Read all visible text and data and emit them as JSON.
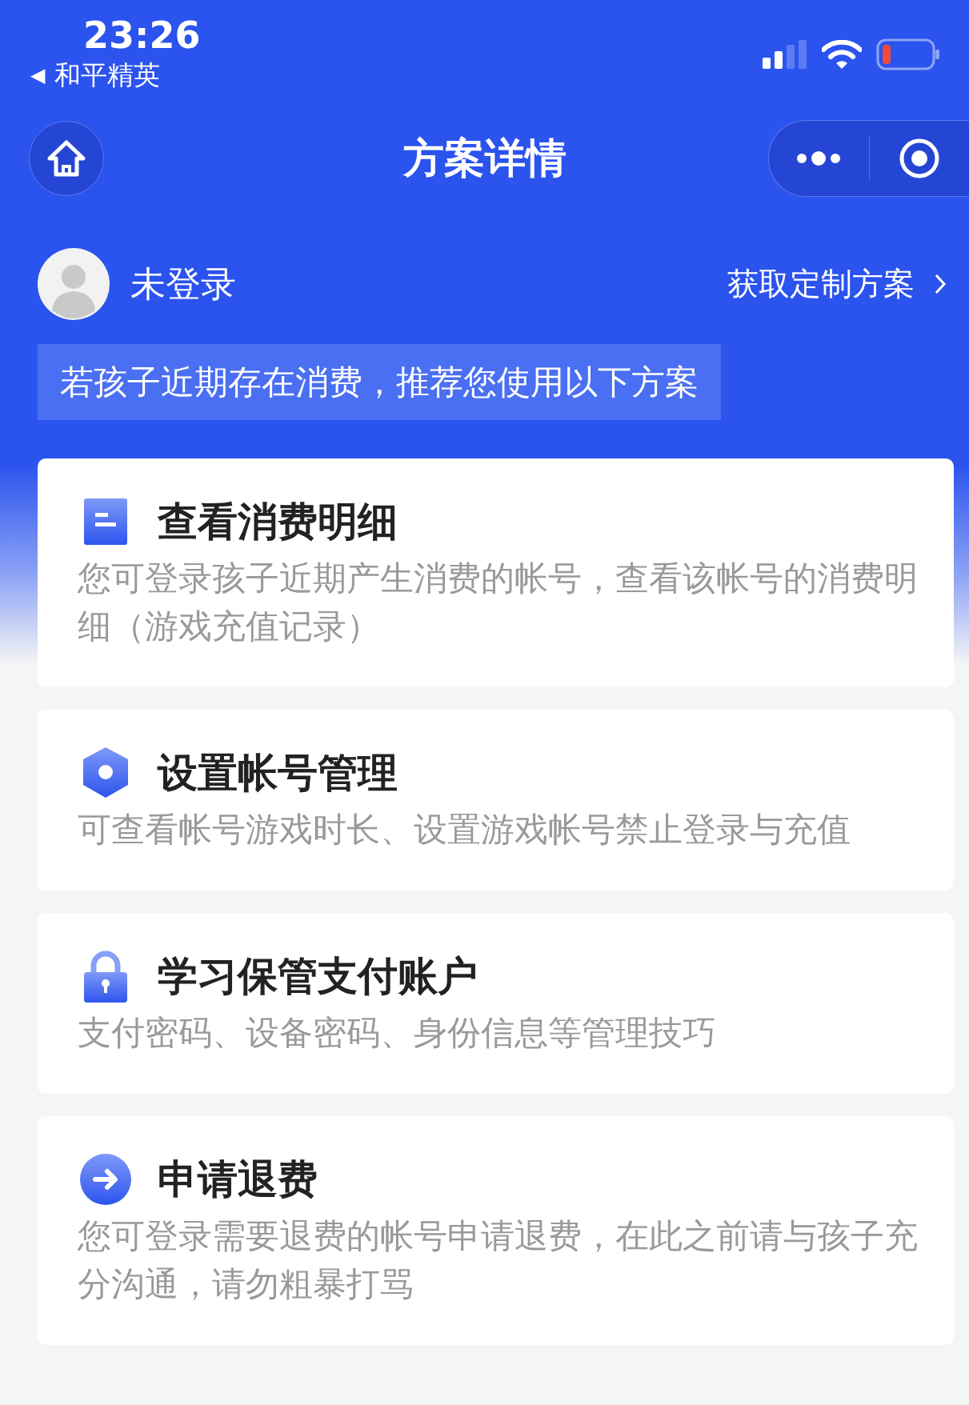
{
  "status_bar": {
    "time": "23:26",
    "back_app": "和平精英",
    "back_arrow": "◀"
  },
  "nav_bar": {
    "title": "方案详情"
  },
  "user": {
    "name": "未登录",
    "link": "获取定制方案"
  },
  "notice": "若孩子近期存在消费，推荐您使用以下方案",
  "cards": [
    {
      "title": "查看消费明细",
      "description": "您可登录孩子近期产生消费的帐号，查看该帐号的消费明细（游戏充值记录）"
    },
    {
      "title": "设置帐号管理",
      "description": "可查看帐号游戏时长、设置游戏帐号禁止登录与充值"
    },
    {
      "title": "学习保管支付账户",
      "description": "支付密码、设备密码、身份信息等管理技巧"
    },
    {
      "title": "申请退费",
      "description": "您可登录需要退费的帐号申请退费，在此之前请与孩子充分沟通，请勿粗暴打骂"
    }
  ]
}
